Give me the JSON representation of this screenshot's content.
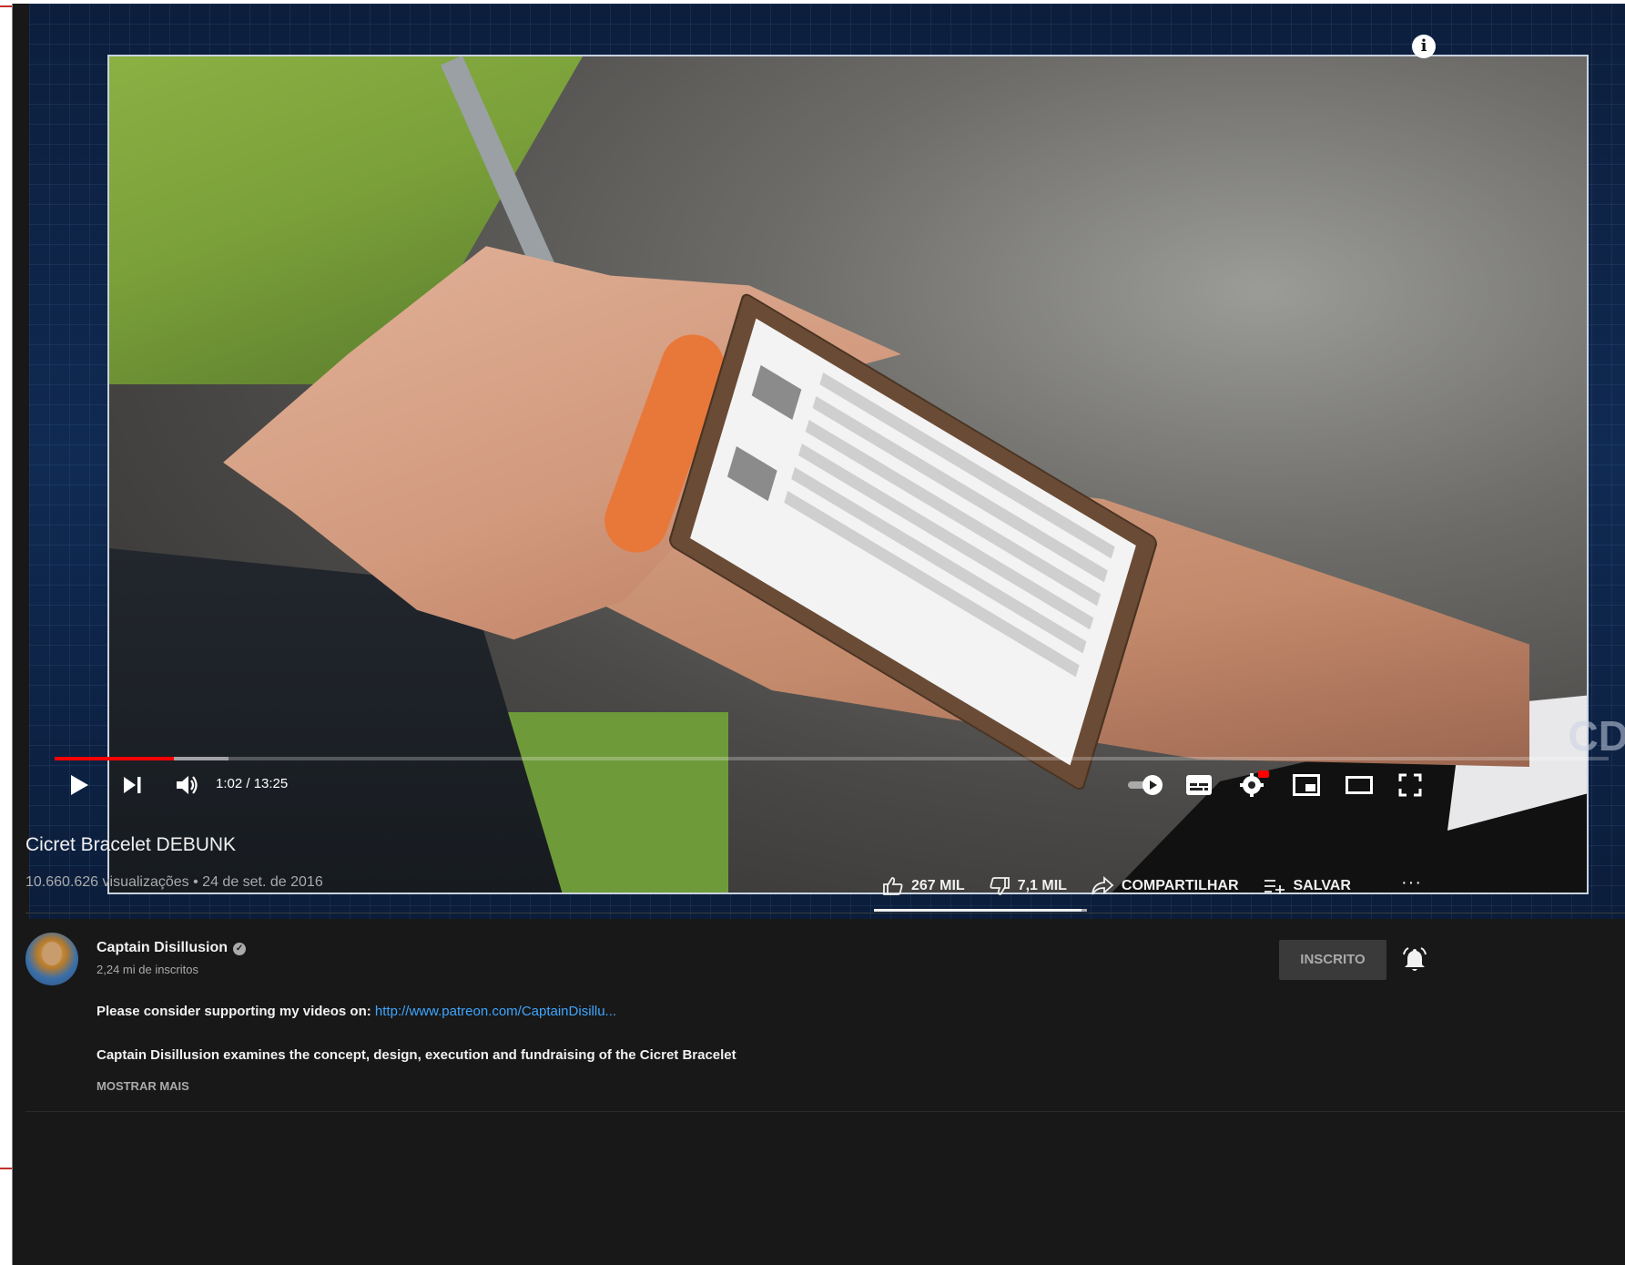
{
  "player": {
    "current_time": "1:02",
    "duration": "13:25",
    "time_display": "1:02 / 13:25",
    "progress_played_fraction": 0.077,
    "progress_loaded_fraction": 0.112,
    "watermark": "CD",
    "info_icon": "info-icon",
    "controls": [
      "play-icon",
      "next-icon",
      "volume-icon",
      "autoplay-toggle",
      "subtitles-icon",
      "settings-icon",
      "miniplayer-icon",
      "theater-icon",
      "fullscreen-icon"
    ],
    "hd_badge": "HD",
    "accent_color": "#ff0000"
  },
  "video": {
    "title": "Cicret Bracelet DEBUNK",
    "meta": "10.660.626 visualizações • 24 de set. de 2016",
    "likes": "267 MIL",
    "dislikes": "7,1 MIL",
    "share_label": "COMPARTILHAR",
    "save_label": "SALVAR",
    "more_label": "···",
    "like_fraction": 0.974
  },
  "channel": {
    "name": "Captain Disillusion",
    "subscribers": "2,24 mi de inscritos",
    "subscribe_label": "INSCRITO",
    "verified_icon": "verified-icon",
    "bell_icon": "bell-icon"
  },
  "description": {
    "line1_text": "Please consider supporting my videos on:",
    "line1_link": "http://www.patreon.com/CaptainDisillu...",
    "line2": "Captain Disillusion examines the concept, design, execution and fundraising of the Cicret Bracelet",
    "show_more": "MOSTRAR MAIS"
  }
}
